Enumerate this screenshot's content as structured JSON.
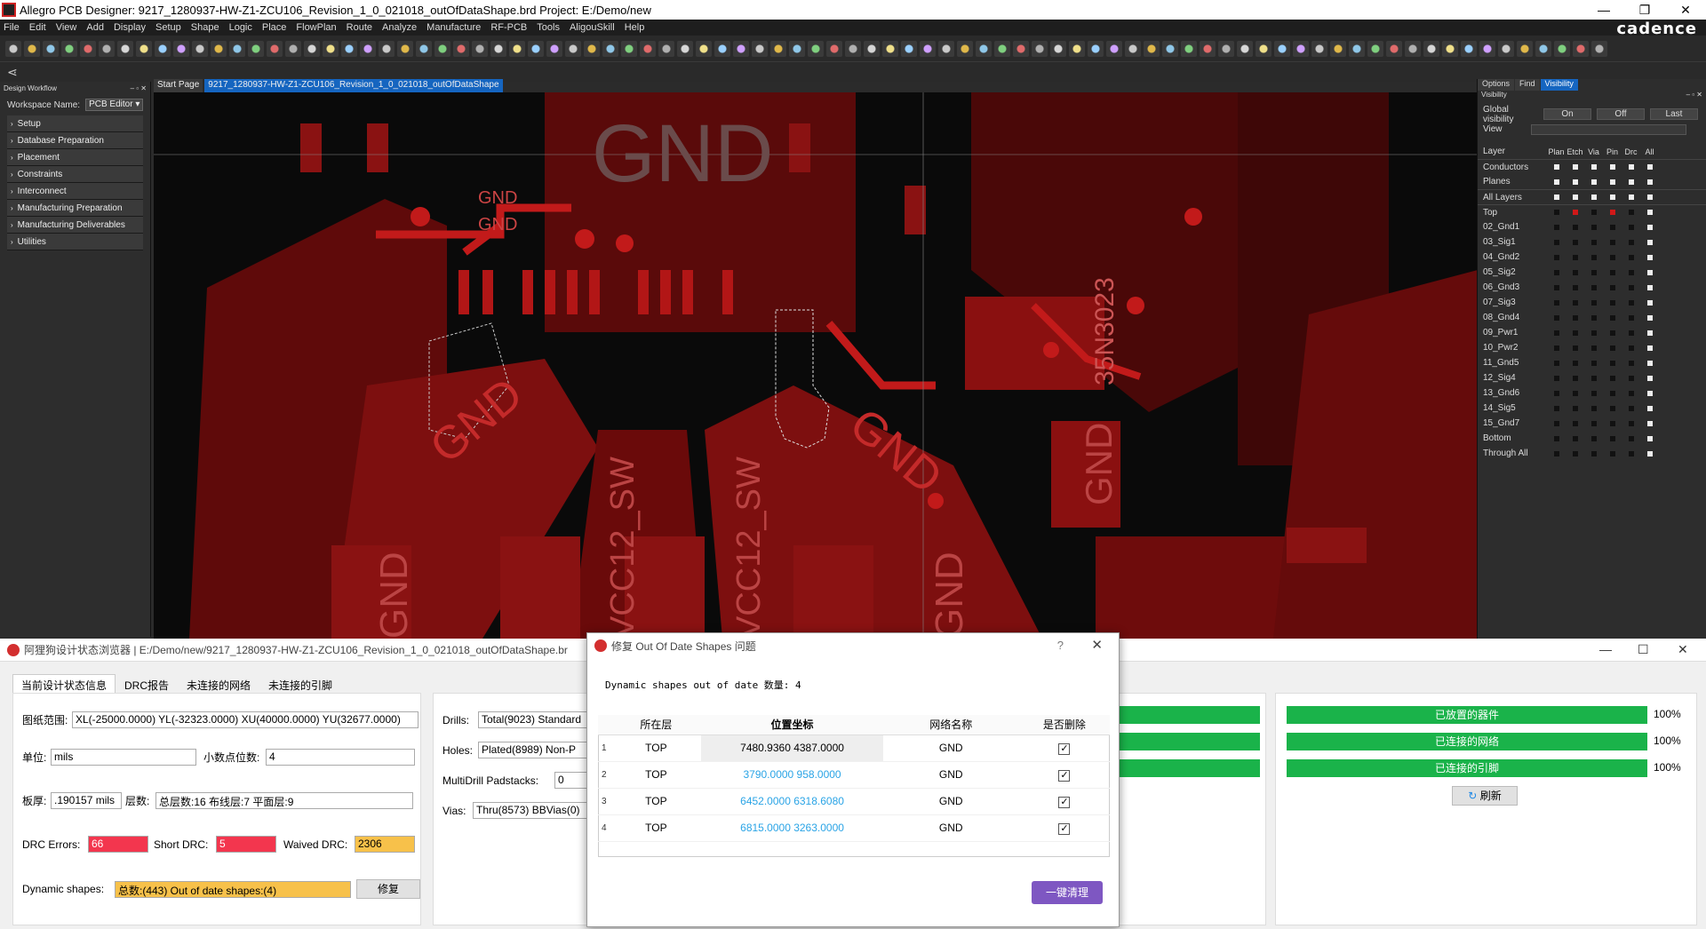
{
  "window": {
    "title": "Allegro PCB Designer: 9217_1280937-HW-Z1-ZCU106_Revision_1_0_021018_outOfDataShape.brd  Project: E:/Demo/new",
    "brand": "cadence"
  },
  "menu": [
    "File",
    "Edit",
    "View",
    "Add",
    "Display",
    "Setup",
    "Shape",
    "Logic",
    "Place",
    "FlowPlan",
    "Route",
    "Analyze",
    "Manufacture",
    "RF-PCB",
    "Tools",
    "AligouSkill",
    "Help"
  ],
  "workflow": {
    "title": "Design Workflow",
    "workspace_label": "Workspace Name:",
    "workspace_value": "PCB Editor",
    "items": [
      {
        "label": "Setup"
      },
      {
        "label": "Database Preparation"
      },
      {
        "label": "Placement"
      },
      {
        "label": "Constraints"
      },
      {
        "label": "Interconnect"
      },
      {
        "label": "Manufacturing Preparation"
      },
      {
        "label": "Manufacturing Deliverables"
      },
      {
        "label": "Utilities"
      }
    ]
  },
  "canvas": {
    "tabs": [
      "Start Page",
      "9217_1280937-HW-Z1-ZCU106_Revision_1_0_021018_outOfDataShape"
    ],
    "labels": [
      "GND",
      "GND",
      "GND",
      "GND",
      "GND",
      "GND",
      "VCC12_SW",
      "VCC12_SW",
      "35N3023",
      "GND",
      "GND"
    ]
  },
  "visibility": {
    "tabs": [
      "Options",
      "Find",
      "Visibility"
    ],
    "title": "Visibility",
    "global_label": "Global visibility",
    "on": "On",
    "off": "Off",
    "last": "Last",
    "view_label": "View",
    "layer_header": "Layer",
    "columns": [
      "Plan",
      "Etch",
      "Via",
      "Pin",
      "Drc",
      "All"
    ],
    "conductors": "Conductors",
    "planes": "Planes",
    "all_layers": "All Layers",
    "layers": [
      "Top",
      "02_Gnd1",
      "03_Sig1",
      "04_Gnd2",
      "05_Sig2",
      "06_Gnd3",
      "07_Sig3",
      "08_Gnd4",
      "09_Pwr1",
      "10_Pwr2",
      "11_Gnd5",
      "12_Sig4",
      "13_Gnd6",
      "14_Sig5",
      "15_Gnd7",
      "Bottom",
      "Through All"
    ]
  },
  "browser": {
    "title": "阿狸狗设计状态浏览器 | E:/Demo/new/9217_1280937-HW-Z1-ZCU106_Revision_1_0_021018_outOfDataShape.br",
    "tabs": [
      "当前设计状态信息",
      "DRC报告",
      "未连接的网络",
      "未连接的引脚"
    ],
    "extent_label": "图纸范围:",
    "extent_value": "XL(-25000.0000)  YL(-32323.0000)  XU(40000.0000)  YU(32677.0000)",
    "unit_label": "单位:",
    "unit_value": "mils",
    "decimal_label": "小数点位数:",
    "decimal_value": "4",
    "thickness_label": "板厚:",
    "thickness_value": ".190157 mils",
    "layers_label": "层数:",
    "layers_value": "总层数:16  布线层:7  平面层:9",
    "drc_label": "DRC Errors:",
    "drc_value": "66",
    "short_label": "Short DRC:",
    "short_value": "5",
    "waived_label": "Waived DRC:",
    "waived_value": "2306",
    "dyn_label": "Dynamic shapes:",
    "dyn_value": "总数:(443)  Out of date shapes:(4)",
    "fix_button": "修复",
    "drills_label": "Drills:",
    "drills_value": "Total(9023)  Standard",
    "holes_label": "Holes:",
    "holes_value": "Plated(8989)  Non-P",
    "multidrill_label": "MultiDrill Padstacks:",
    "multidrill_value": "0",
    "vias_label": "Vias:",
    "vias_value": "Thru(8573)  BBVias(0)",
    "progress": [
      {
        "label": "已放置的器件",
        "pct": "100%",
        "value": 1.0
      },
      {
        "label": "已连接的网络",
        "pct": "100%",
        "value": 1.0
      },
      {
        "label": "已连接的引脚",
        "pct": "100%",
        "value": 1.0
      }
    ],
    "refresh": "刷新"
  },
  "dialog": {
    "title": "修复 Out Of Date Shapes 问题",
    "help": "?",
    "count_text": "Dynamic shapes out of date 数量:  4",
    "columns": [
      "所在层",
      "位置坐标",
      "网络名称",
      "是否删除"
    ],
    "rows": [
      {
        "idx": "1",
        "layer": "TOP",
        "pos": "7480.9360 4387.0000",
        "net": "GND",
        "checked": "✓"
      },
      {
        "idx": "2",
        "layer": "TOP",
        "pos": "3790.0000 958.0000",
        "net": "GND",
        "checked": "✓"
      },
      {
        "idx": "3",
        "layer": "TOP",
        "pos": "6452.0000 6318.6080",
        "net": "GND",
        "checked": "✓"
      },
      {
        "idx": "4",
        "layer": "TOP",
        "pos": "6815.0000 3263.0000",
        "net": "GND",
        "checked": "✓"
      }
    ],
    "clean_button": "一键清理"
  }
}
